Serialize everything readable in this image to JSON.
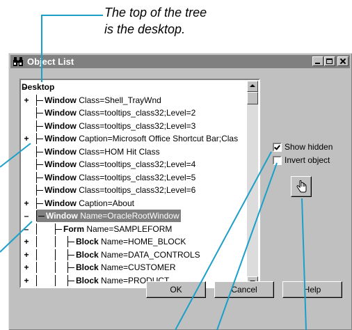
{
  "callout": {
    "line1": "The top of the tree",
    "line2": "is the desktop."
  },
  "window": {
    "title": "Object List",
    "title_icon": "binoculars-icon",
    "controls": [
      "minimize-icon",
      "maximize-icon",
      "close-icon"
    ]
  },
  "tree": {
    "items": [
      {
        "expander": "–",
        "type": "Desktop",
        "detail": ""
      },
      {
        "expander": "+",
        "type": "Window",
        "detail": "Class=Shell_TrayWnd"
      },
      {
        "expander": "",
        "type": "Window",
        "detail": "Class=tooltips_class32;Level=2"
      },
      {
        "expander": "",
        "type": "Window",
        "detail": "Class=tooltips_class32;Level=3"
      },
      {
        "expander": "+",
        "type": "Window",
        "detail": "Caption=Microsoft Office Shortcut Bar;Clas"
      },
      {
        "expander": "",
        "type": "Window",
        "detail": "Class=HOM Hit Class"
      },
      {
        "expander": "",
        "type": "Window",
        "detail": "Class=tooltips_class32;Level=4"
      },
      {
        "expander": "",
        "type": "Window",
        "detail": "Class=tooltips_class32;Level=5"
      },
      {
        "expander": "",
        "type": "Window",
        "detail": "Class=tooltips_class32;Level=6"
      },
      {
        "expander": "+",
        "type": "Window",
        "detail": "Caption=About"
      },
      {
        "expander": "–",
        "type": "Window",
        "detail": "Name=OracleRootWindow"
      },
      {
        "expander": "–",
        "type": "Form",
        "detail": "Name=SAMPLEFORM"
      },
      {
        "expander": "+",
        "type": "Block",
        "detail": "Name=HOME_BLOCK"
      },
      {
        "expander": "+",
        "type": "Block",
        "detail": "Name=DATA_CONTROLS"
      },
      {
        "expander": "+",
        "type": "Block",
        "detail": "Name=CUSTOMER"
      },
      {
        "expander": "+",
        "type": "Block",
        "detail": "Name=PRODUCT"
      }
    ],
    "selected_index": 10
  },
  "options": {
    "show_hidden_label": "Show hidden",
    "show_hidden_checked": true,
    "invert_object_label": "Invert object",
    "invert_object_checked": false,
    "pick_button_icon": "hand-pointer-icon"
  },
  "buttons": {
    "ok": "OK",
    "cancel": "Cancel",
    "help": "Help"
  },
  "colors": {
    "callout_line": "#1aa0c8",
    "titlebar": "#808080",
    "window_face": "#c0c0c0",
    "selection": "#808080"
  }
}
